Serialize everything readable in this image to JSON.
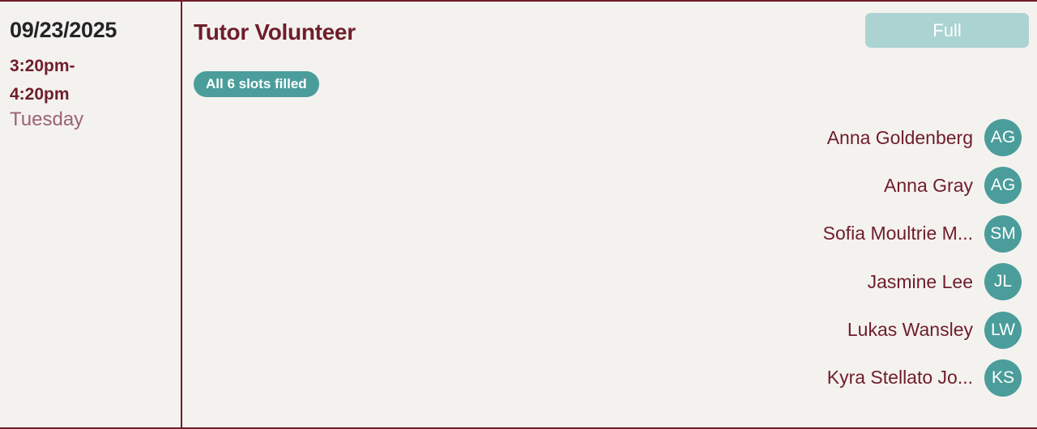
{
  "slot": {
    "date": "09/23/2025",
    "time_line1": "3:20pm-",
    "time_line2": "4:20pm",
    "weekday": "Tuesday"
  },
  "role": {
    "title": "Tutor Volunteer",
    "status_button_label": "Full",
    "slots_badge": "All 6 slots filled"
  },
  "volunteers": [
    {
      "name": "Anna Goldenberg",
      "initials": "AG"
    },
    {
      "name": "Anna Gray",
      "initials": "AG"
    },
    {
      "name": "Sofia Moultrie M...",
      "initials": "SM"
    },
    {
      "name": "Jasmine Lee",
      "initials": "JL"
    },
    {
      "name": "Lukas Wansley",
      "initials": "LW"
    },
    {
      "name": "Kyra Stellato Jo...",
      "initials": "KS"
    }
  ],
  "colors": {
    "brand_maroon": "#6f1d2a",
    "accent_teal": "#4a9d9b",
    "disabled_teal": "#abd3d2",
    "background": "#f4f2ef"
  }
}
